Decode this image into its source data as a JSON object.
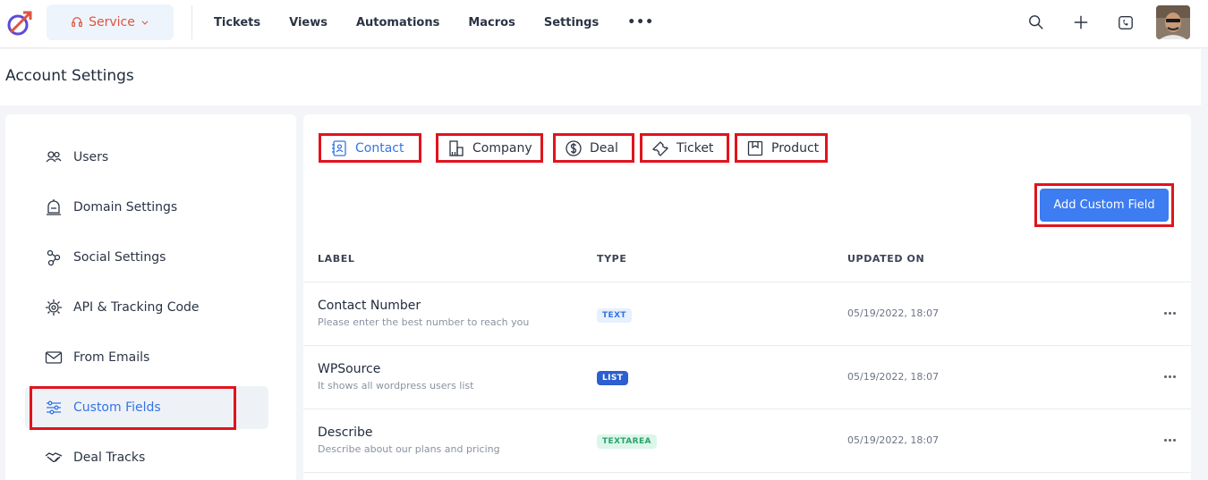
{
  "header": {
    "service_label": "Service",
    "nav": [
      "Tickets",
      "Views",
      "Automations",
      "Macros",
      "Settings"
    ],
    "more_label": "•••"
  },
  "page": {
    "title": "Account Settings"
  },
  "sidebar": {
    "items": [
      {
        "label": "Users",
        "icon": "users-icon"
      },
      {
        "label": "Domain Settings",
        "icon": "domain-icon"
      },
      {
        "label": "Social Settings",
        "icon": "share-icon"
      },
      {
        "label": "API & Tracking Code",
        "icon": "api-gear-icon"
      },
      {
        "label": "From Emails",
        "icon": "mail-icon"
      },
      {
        "label": "Custom Fields",
        "icon": "sliders-icon",
        "active": true
      },
      {
        "label": "Deal Tracks",
        "icon": "handshake-icon"
      }
    ]
  },
  "tabs": [
    {
      "label": "Contact",
      "icon": "contact-book-icon",
      "active": true
    },
    {
      "label": "Company",
      "icon": "building-icon"
    },
    {
      "label": "Deal",
      "icon": "dollar-coin-icon"
    },
    {
      "label": "Ticket",
      "icon": "ticket-icon"
    },
    {
      "label": "Product",
      "icon": "product-box-icon"
    }
  ],
  "actions": {
    "add_custom_field": "Add Custom Field"
  },
  "table": {
    "columns": [
      "LABEL",
      "TYPE",
      "UPDATED ON"
    ],
    "rows": [
      {
        "label": "Contact Number",
        "description": "Please enter the best number to reach you",
        "type": "TEXT",
        "updated": "05/19/2022, 18:07"
      },
      {
        "label": "WPSource",
        "description": "It shows all wordpress users list",
        "type": "LIST",
        "updated": "05/19/2022, 18:07"
      },
      {
        "label": "Describe",
        "description": "Describe about our plans and pricing",
        "type": "TEXTAREA",
        "updated": "05/19/2022, 18:07"
      }
    ]
  },
  "colors": {
    "accent": "#3d7cf1",
    "service": "#e0533d",
    "highlight": "#e0141e"
  }
}
